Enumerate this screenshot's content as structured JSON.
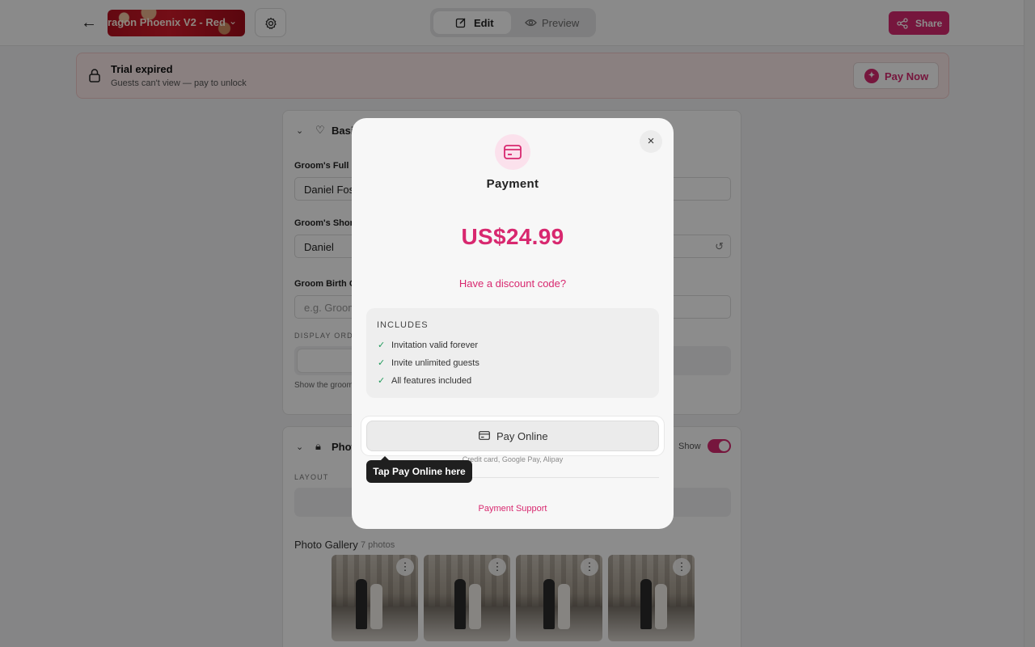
{
  "topbar": {
    "template_name": "ragon Phoenix V2 - Red",
    "mode_edit": "Edit",
    "mode_preview": "Preview",
    "share": "Share"
  },
  "banner": {
    "title": "Trial expired",
    "subtitle": "Guests can't view — pay to unlock",
    "pay_now": "Pay Now"
  },
  "basics": {
    "title": "Basi",
    "grooms_full_label": "Groom's Full N",
    "grooms_full_value": "Daniel Fos",
    "grooms_short_label": "Groom's Shor",
    "grooms_short_value": "Daniel",
    "birth_label": "Groom Birth O",
    "birth_placeholder": "e.g. Groom",
    "display_order_label": "DISPLAY ORDE",
    "helper": "Show the groom"
  },
  "photos": {
    "title": "Phot",
    "show_label": "Show",
    "layout_label": "LAYOUT",
    "gallery_title": "Photo Gallery",
    "gallery_count": "7 photos",
    "photo_menu": "⋮"
  },
  "modal": {
    "title": "Payment",
    "price": "US$24.99",
    "discount_link": "Have a discount code?",
    "includes_heading": "INCLUDES",
    "includes": [
      "Invitation valid forever",
      "Invite unlimited guests",
      "All features included"
    ],
    "pay_online": "Pay Online",
    "pay_methods": "Credit card, Google Pay, Alipay",
    "support": "Payment Support",
    "close": "×"
  },
  "tooltip": {
    "text": "Tap Pay Online here"
  },
  "colors": {
    "accent": "#d8286f",
    "success": "#1f9a5a",
    "banner_bg": "#fbeaea"
  }
}
